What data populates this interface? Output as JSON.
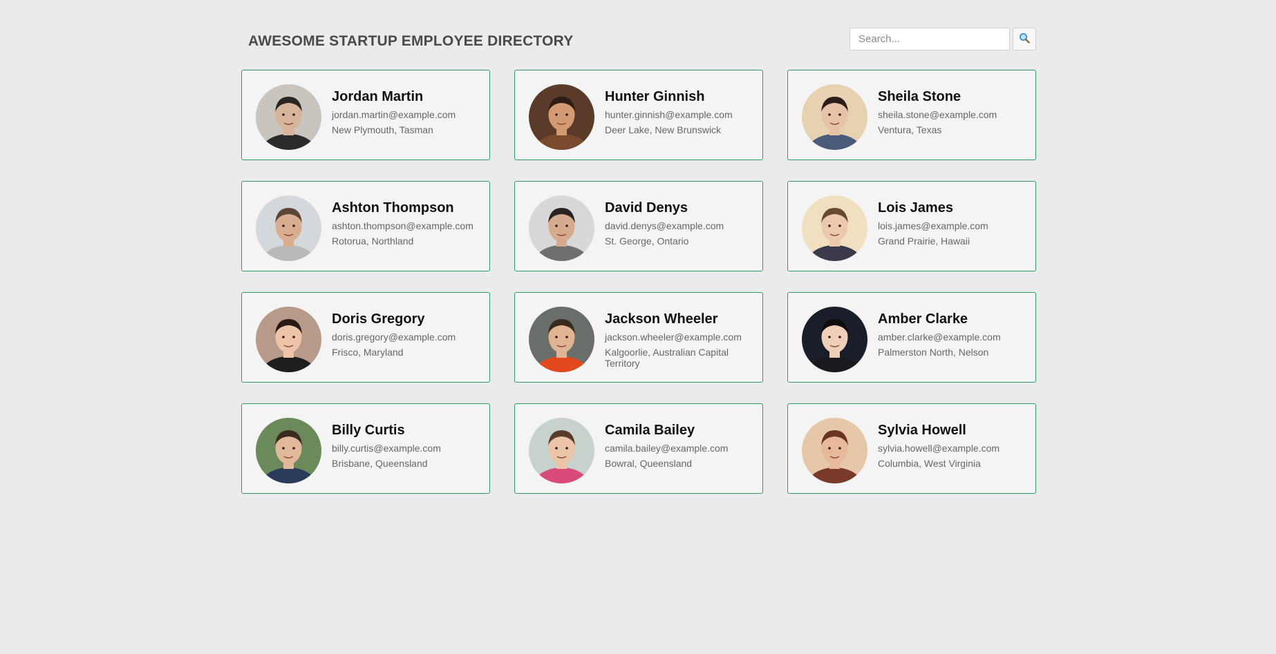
{
  "header": {
    "title": "AWESOME STARTUP EMPLOYEE DIRECTORY",
    "search_placeholder": "Search...",
    "search_value": "",
    "search_icon": "magnifying-glass-icon",
    "search_glyph": "🔍"
  },
  "colors": {
    "background": "#ebebeb",
    "card_background": "#f4f4f4",
    "card_border": "#2e9a6a",
    "title": "#4a4a4a",
    "name": "#111111",
    "detail": "#666666"
  },
  "employees": [
    {
      "name": "Jordan Martin",
      "email": "jordan.martin@example.com",
      "location": "New Plymouth, Tasman",
      "bg": "#c9c4bd",
      "skin": "#d8b49a",
      "hair": "#2a2522",
      "shirt": "#2b2b2b"
    },
    {
      "name": "Hunter Ginnish",
      "email": "hunter.ginnish@example.com",
      "location": "Deer Lake, New Brunswick",
      "bg": "#5a3b2a",
      "skin": "#d49a72",
      "hair": "#2d1d14",
      "shirt": "#7a4a2c"
    },
    {
      "name": "Sheila Stone",
      "email": "sheila.stone@example.com",
      "location": "Ventura, Texas",
      "bg": "#e6d2b0",
      "skin": "#e8c2a6",
      "hair": "#2b1e1a",
      "shirt": "#4a5a7a"
    },
    {
      "name": "Ashton Thompson",
      "email": "ashton.thompson@example.com",
      "location": "Rotorua, Northland",
      "bg": "#d4d8dc",
      "skin": "#d9ad8f",
      "hair": "#5a4636",
      "shirt": "#b9b9b9"
    },
    {
      "name": "David Denys",
      "email": "david.denys@example.com",
      "location": "St. George, Ontario",
      "bg": "#d8d8d8",
      "skin": "#d6aa8c",
      "hair": "#2a2420",
      "shirt": "#6e6e6e"
    },
    {
      "name": "Lois James",
      "email": "lois.james@example.com",
      "location": "Grand Prairie, Hawaii",
      "bg": "#f0e0c0",
      "skin": "#ecc8ac",
      "hair": "#6a4a2e",
      "shirt": "#3a3a4a"
    },
    {
      "name": "Doris Gregory",
      "email": "doris.gregory@example.com",
      "location": "Frisco, Maryland",
      "bg": "#b89a8a",
      "skin": "#edc4a8",
      "hair": "#2a1a16",
      "shirt": "#1e1e1e"
    },
    {
      "name": "Jackson Wheeler",
      "email": "jackson.wheeler@example.com",
      "location": "Kalgoorlie, Australian Capital Territory",
      "bg": "#6a6e6a",
      "skin": "#e0b392",
      "hair": "#3a2a1e",
      "shirt": "#e24a1e"
    },
    {
      "name": "Amber Clarke",
      "email": "amber.clarke@example.com",
      "location": "Palmerston North, Nelson",
      "bg": "#1a1e2a",
      "skin": "#efcfb8",
      "hair": "#0e0e12",
      "shirt": "#1a1a1e"
    },
    {
      "name": "Billy Curtis",
      "email": "billy.curtis@example.com",
      "location": "Brisbane, Queensland",
      "bg": "#6a8a5a",
      "skin": "#e2b89a",
      "hair": "#3a2a20",
      "shirt": "#2a3a5a"
    },
    {
      "name": "Camila Bailey",
      "email": "camila.bailey@example.com",
      "location": "Bowral, Queensland",
      "bg": "#c8d2cc",
      "skin": "#ecc4a8",
      "hair": "#5a3a2a",
      "shirt": "#d84a7a"
    },
    {
      "name": "Sylvia Howell",
      "email": "sylvia.howell@example.com",
      "location": "Columbia, West Virginia",
      "bg": "#e6c8a8",
      "skin": "#e8b89a",
      "hair": "#6a3420",
      "shirt": "#7a3a2a"
    }
  ]
}
